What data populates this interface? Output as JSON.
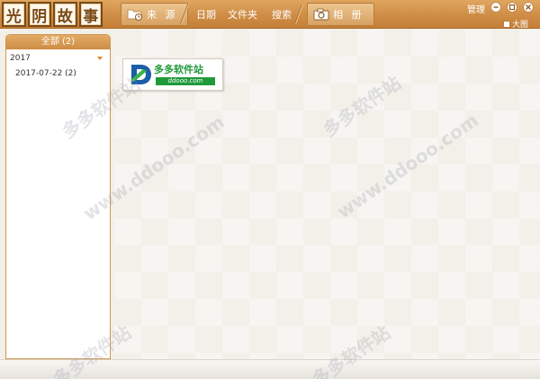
{
  "header": {
    "logo_chars": [
      "光",
      "阴",
      "故",
      "事"
    ],
    "tabs": {
      "source": "来 源",
      "date": "日期",
      "folder": "文件夹",
      "search": "搜索",
      "album": "相 册"
    },
    "manage_label": "管理",
    "big_image_label": "大图"
  },
  "sidebar": {
    "title": "全部 (2)",
    "year": "2017",
    "date_item": "2017-07-22 (2)"
  },
  "main": {
    "thumbnail": {
      "title": "多多软件站",
      "url": "ddooo.com"
    }
  },
  "watermark": {
    "text_cn": "多多软件站",
    "text_url": "www.ddooo.com"
  },
  "colors": {
    "header_bg": "#cf8d46",
    "accent_green": "#1f9a3a",
    "logo_blue": "#1c5ea8",
    "caret_orange": "#e8832a"
  }
}
